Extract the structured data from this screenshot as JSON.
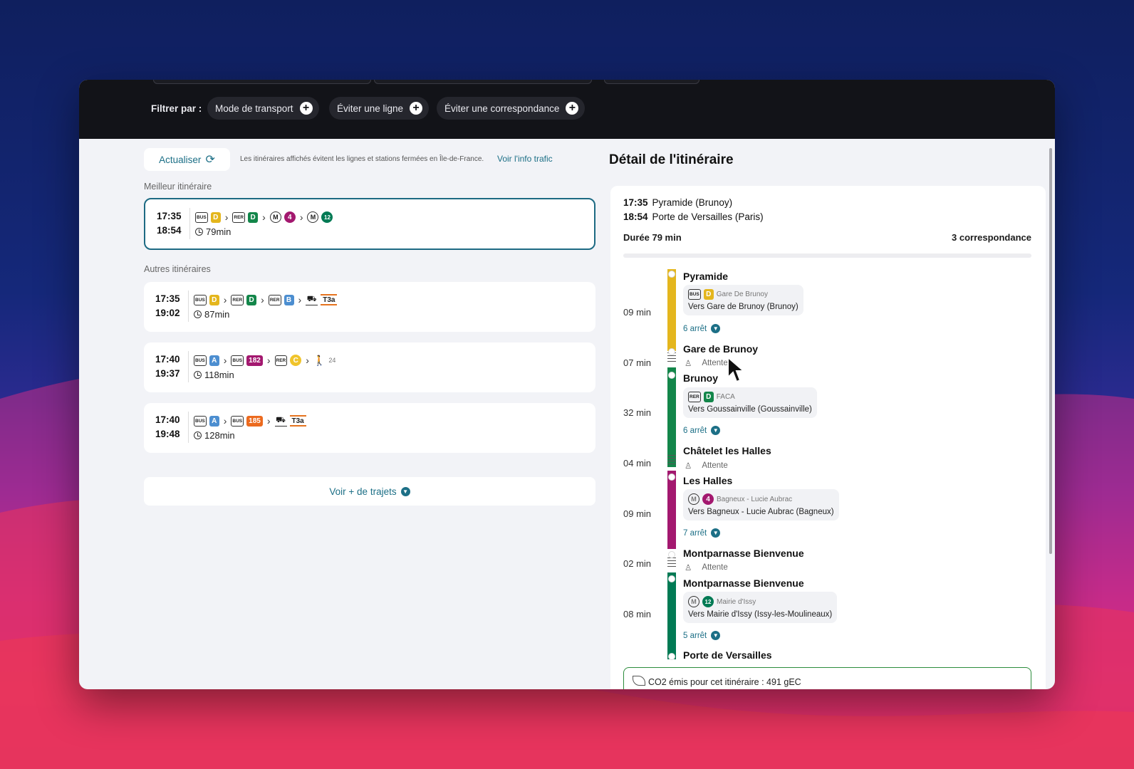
{
  "filter": {
    "label": "Filtrer par :",
    "chips": [
      "Mode de transport",
      "Éviter une ligne",
      "Éviter une correspondance"
    ]
  },
  "left": {
    "refresh_label": "Actualiser",
    "note": "Les itinéraires affichés évitent les lignes et stations fermées en Île-de-France.",
    "info_link": "Voir l'info trafic",
    "best_title": "Meilleur itinéraire",
    "others_title": "Autres itinéraires",
    "more_label": "Voir + de trajets",
    "itineraries": [
      {
        "dep": "17:35",
        "arr": "18:54",
        "duration": "79min"
      },
      {
        "dep": "17:35",
        "arr": "19:02",
        "duration": "87min"
      },
      {
        "dep": "17:40",
        "arr": "19:37",
        "duration": "118min"
      },
      {
        "dep": "17:40",
        "arr": "19:48",
        "duration": "128min"
      }
    ],
    "mode_labels": {
      "bus": "BUS",
      "rer": "RER",
      "metro": "M",
      "walk_count": "24"
    },
    "line_labels": {
      "D": "D",
      "B": "B",
      "A": "A",
      "C": "C",
      "4": "4",
      "12": "12",
      "182": "182",
      "185": "185",
      "T3a": "T3a"
    },
    "line_colors": {
      "bus_d": "#e4b61d",
      "rer_d": "#13864a",
      "rer_b": "#4c8ed0",
      "bus_a": "#4c8ed0",
      "rer_c": "#f0c42b",
      "metro_4": "#a3186f",
      "metro_12": "#007a54",
      "bus_182": "#a3186f",
      "bus_185": "#ec6a1e"
    }
  },
  "detail": {
    "title": "Détail de l'itinéraire",
    "dep_time": "17:35",
    "dep_place": "Pyramide (Brunoy)",
    "arr_time": "18:54",
    "arr_place": "Porte de Versailles (Paris)",
    "duration": "Durée 79 min",
    "transfers": "3 correspondance",
    "mins": [
      "09 min",
      "07 min",
      "32 min",
      "04 min",
      "09 min",
      "02 min",
      "08 min"
    ],
    "stops": [
      "Pyramide",
      "Gare de Brunoy",
      "Brunoy",
      "Châtelet les Halles",
      "Les Halles",
      "Montparnasse Bienvenue",
      "Montparnasse Bienvenue",
      "Porte de Versailles"
    ],
    "legs": [
      {
        "from": "Gare De Brunoy",
        "dir": "Vers Gare de Brunoy (Brunoy)",
        "arrets": "6 arrêt"
      },
      {
        "from": "FACA",
        "dir": "Vers Goussainville (Goussainville)",
        "arrets": "6 arrêt"
      },
      {
        "from": "Bagneux - Lucie Aubrac",
        "dir": "Vers Bagneux - Lucie Aubrac (Bagneux)",
        "arrets": "7 arrêt"
      },
      {
        "from": "Mairie d'Issy",
        "dir": "Vers Mairie d'Issy (Issy-les-Moulineaux)",
        "arrets": "5 arrêt"
      }
    ],
    "waits": [
      "Attente",
      "Attente",
      "Attente"
    ],
    "co2": "CO2 émis pour cet itinéraire : 491 gEC"
  }
}
